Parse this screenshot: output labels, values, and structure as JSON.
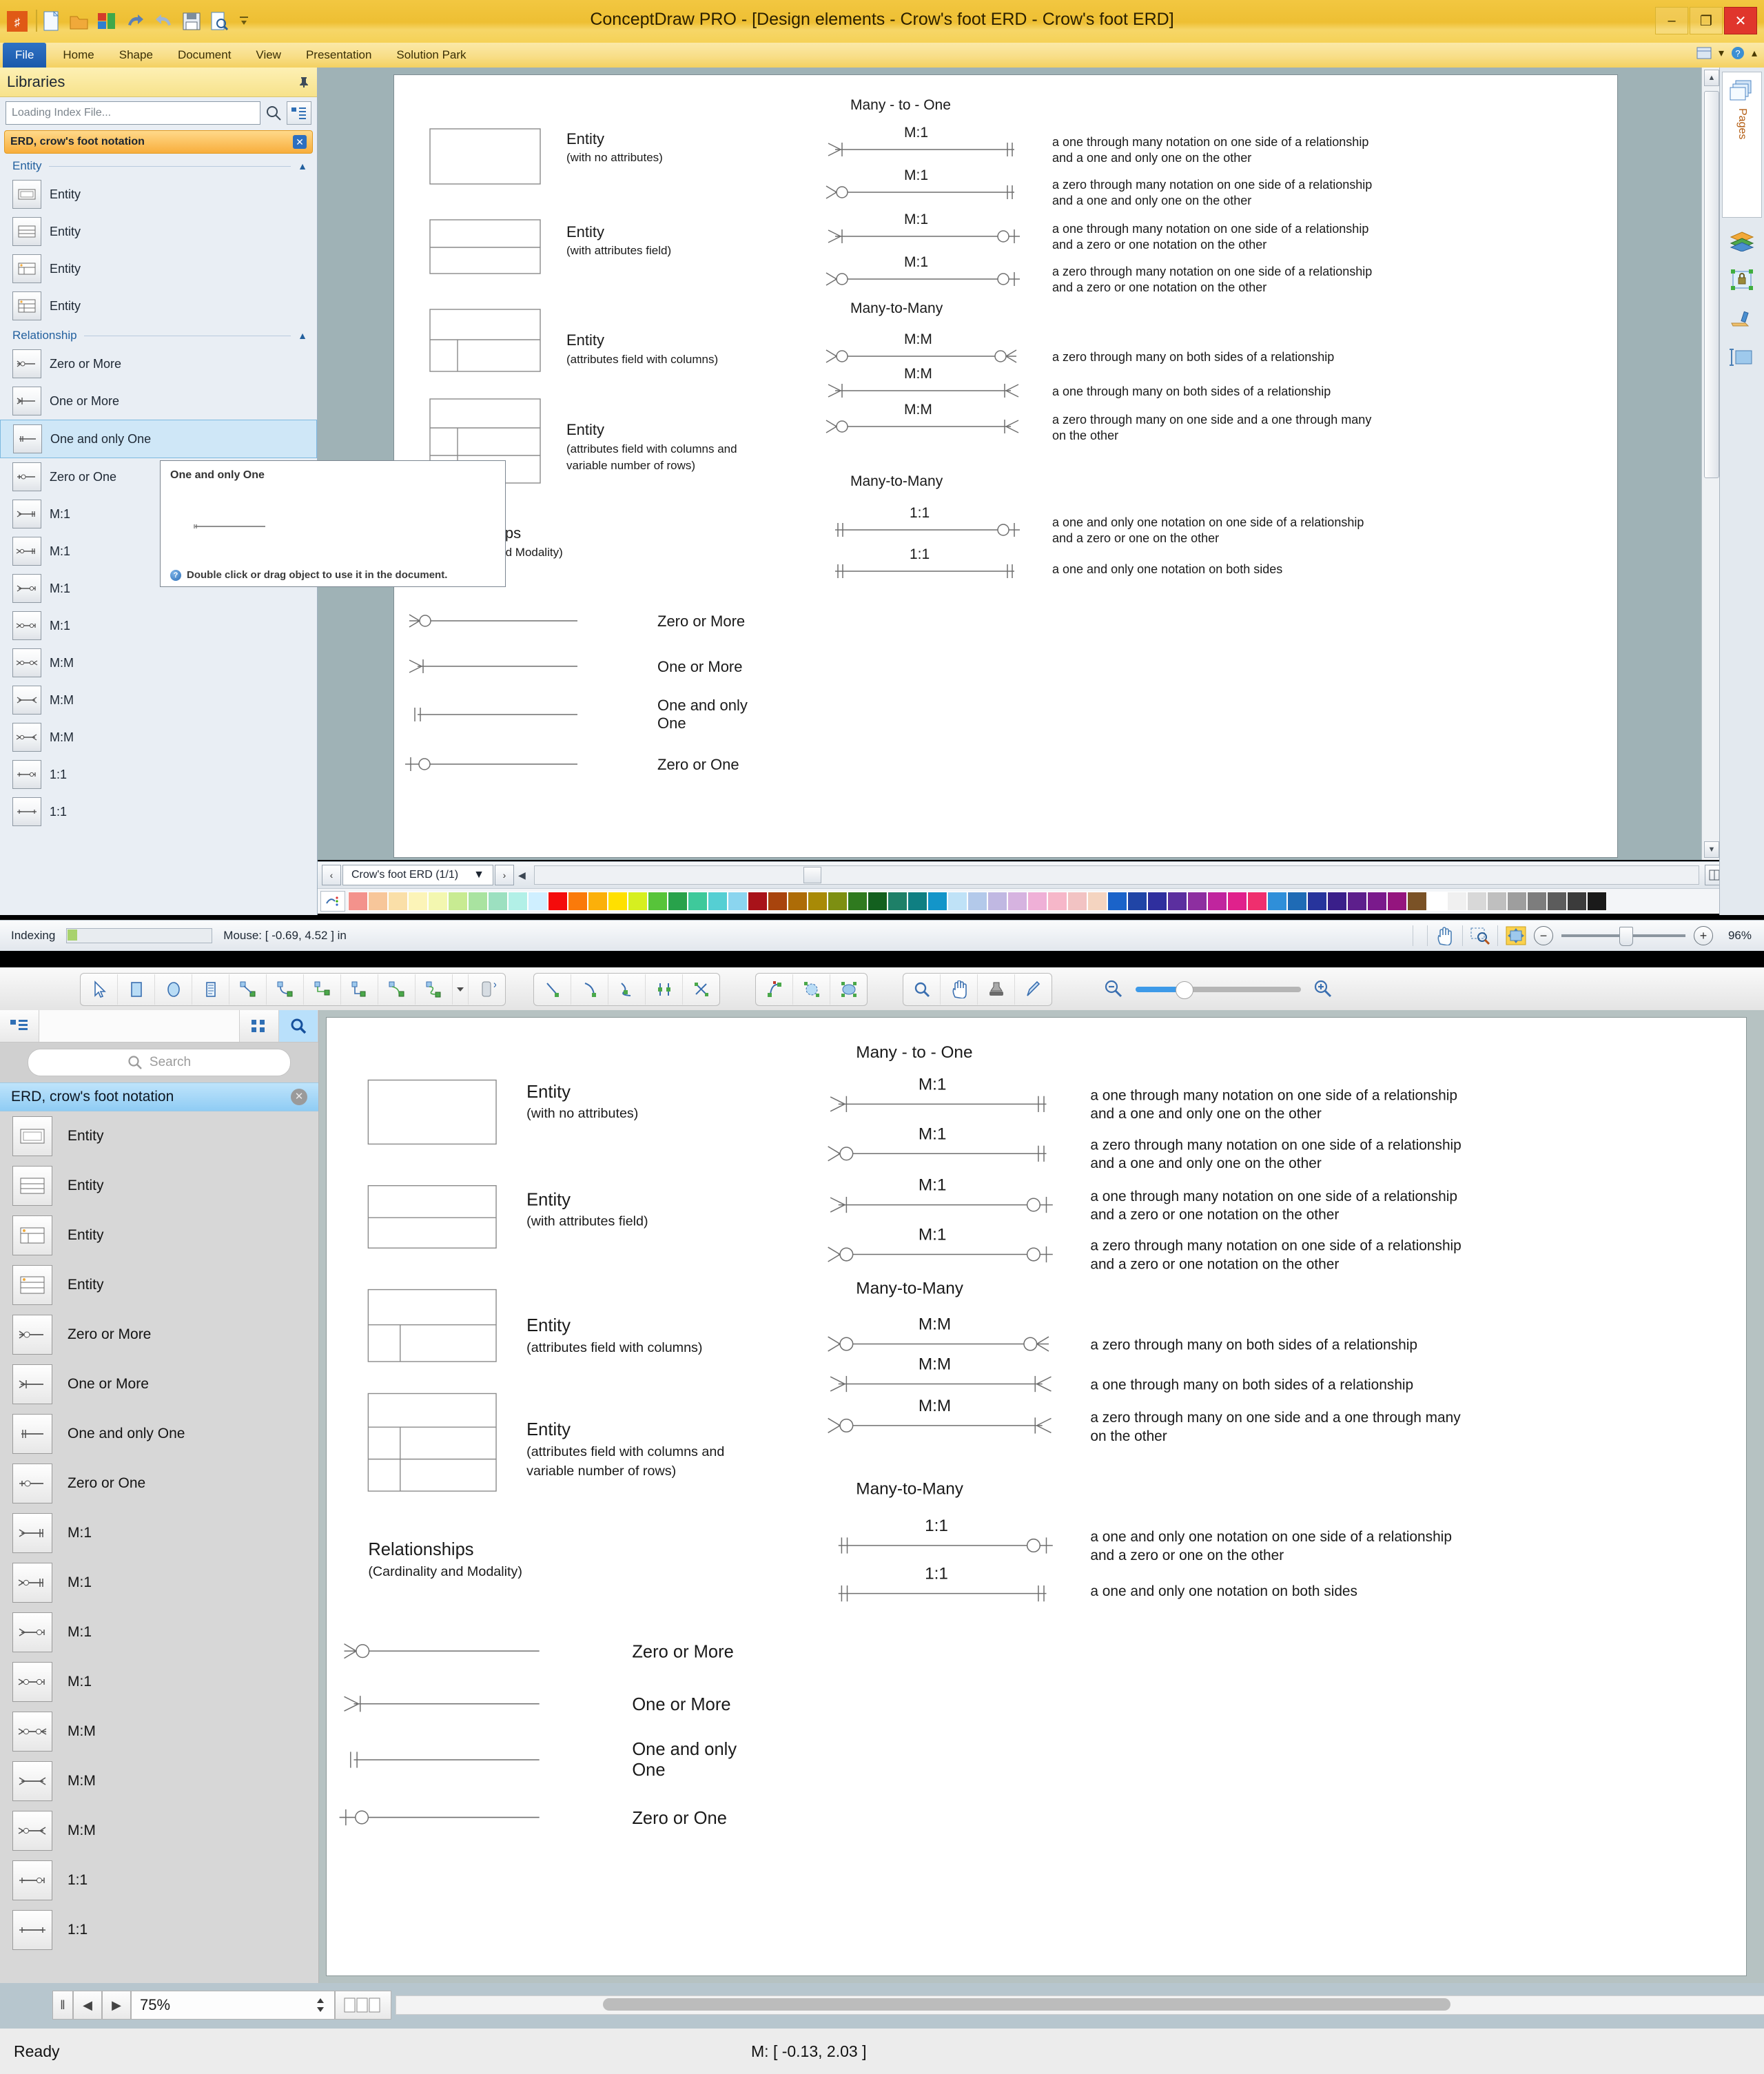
{
  "window": {
    "title": "ConceptDraw PRO - [Design elements - Crow's foot ERD - Crow's foot ERD]",
    "minimize": "–",
    "restore": "❐",
    "close": "✕"
  },
  "ribbon": {
    "tabs": [
      "File",
      "Home",
      "Shape",
      "Document",
      "View",
      "Presentation",
      "Solution Park"
    ],
    "right_icons": [
      "window-icon",
      "help-icon",
      "chevron-down-icon",
      "minimize-ribbon-icon"
    ]
  },
  "quick_access": {
    "icons": [
      "app-logo-icon",
      "new-document-icon",
      "open-folder-icon",
      "save-as-icon",
      "undo-icon",
      "redo-icon",
      "save-icon",
      "print-preview-icon",
      "customize-qat-icon"
    ]
  },
  "libraries_panel": {
    "header": "Libraries",
    "pin_icon": "pin-icon",
    "search_value": "Loading Index File...",
    "search_icon": "search-icon",
    "tree_view_icon": "tree-view-icon",
    "library_title": "ERD, crow's foot notation",
    "close_icon": "✕",
    "groups": [
      {
        "name": "Entity",
        "collapse_icon": "chevron-up-icon",
        "items": [
          {
            "label": "Entity",
            "shape": "entity-plain"
          },
          {
            "label": "Entity",
            "shape": "entity-attr"
          },
          {
            "label": "Entity",
            "shape": "entity-cols"
          },
          {
            "label": "Entity",
            "shape": "entity-rows"
          }
        ]
      },
      {
        "name": "Relationship",
        "collapse_icon": "chevron-up-icon",
        "items": [
          {
            "label": "Zero or More",
            "shape": "rel-zero-more",
            "selected": false
          },
          {
            "label": "One or More",
            "shape": "rel-one-more",
            "selected": false
          },
          {
            "label": "One and only One",
            "shape": "rel-one-only",
            "selected": true
          },
          {
            "label": "Zero or One",
            "shape": "rel-zero-one",
            "selected": false
          },
          {
            "label": "M:1",
            "shape": "rel-m1-a",
            "selected": false
          },
          {
            "label": "M:1",
            "shape": "rel-m1-b",
            "selected": false
          },
          {
            "label": "M:1",
            "shape": "rel-m1-c",
            "selected": false
          },
          {
            "label": "M:1",
            "shape": "rel-m1-d",
            "selected": false
          },
          {
            "label": "M:M",
            "shape": "rel-mm-a",
            "selected": false
          },
          {
            "label": "M:M",
            "shape": "rel-mm-b",
            "selected": false
          },
          {
            "label": "M:M",
            "shape": "rel-mm-c",
            "selected": false
          },
          {
            "label": "1:1",
            "shape": "rel-11-a",
            "selected": false
          },
          {
            "label": "1:1",
            "shape": "rel-11-b",
            "selected": false
          }
        ]
      }
    ]
  },
  "tooltip": {
    "title": "One and only One",
    "hint": "Double click or drag object to use it in the document.",
    "help_icon": "help-icon"
  },
  "page_bar": {
    "prev": "‹",
    "next": "›",
    "tab_label": "Crow's foot ERD (1/1)",
    "dropdown_icon": "▼",
    "scroll_left": "◀",
    "split_icon": "split-view-icon"
  },
  "status_bar": {
    "indexing_label": "Indexing",
    "mouse_label": "Mouse: [ -0.69, 4.52 ] in",
    "hand_icon": "hand-icon",
    "zoom_region_icon": "zoom-region-icon",
    "fit_icon": "fit-to-page-icon",
    "zoom_out": "−",
    "zoom_in": "+",
    "zoom_value": "96%"
  },
  "right_dock": {
    "pages_label": "Pages",
    "pages_icon": "pages-icon",
    "icons": [
      "layers-icon",
      "lock-shape-icon",
      "format-painter-icon",
      "size-position-icon"
    ]
  },
  "diagram": {
    "entities": [
      {
        "name": "Entity",
        "sub": "(with no attributes)",
        "shape": "entity-plain"
      },
      {
        "name": "Entity",
        "sub": "(with attributes field)",
        "shape": "entity-attr"
      },
      {
        "name": "Entity",
        "sub": "(attributes field with columns)",
        "shape": "entity-cols"
      },
      {
        "name": "Entity",
        "sub": "(attributes field with columns and\nvariable number of rows)",
        "shape": "entity-rows"
      }
    ],
    "relationships_title": "Relationships",
    "relationships_sub": "(Cardinality and Modality)",
    "relationships": [
      {
        "label": "Zero or More",
        "end": "zero-more"
      },
      {
        "label": "One or More",
        "end": "one-more"
      },
      {
        "label": "One and only\nOne",
        "end": "one-only"
      },
      {
        "label": "Zero or One",
        "end": "zero-one"
      }
    ],
    "sections": [
      {
        "title": "Many - to - One",
        "rows": [
          {
            "card": "M:1",
            "left": "one-more",
            "right": "one-only",
            "desc": "a one through many notation on one side of a relationship\nand a one and only one on the other"
          },
          {
            "card": "M:1",
            "left": "zero-more",
            "right": "one-only",
            "desc": "a zero through many notation on one side of a relationship\nand a one and only one on the other"
          },
          {
            "card": "M:1",
            "left": "one-more",
            "right": "zero-one",
            "desc": "a one through many notation on one side of a relationship\nand a zero or one notation on the other"
          },
          {
            "card": "M:1",
            "left": "zero-more",
            "right": "zero-one",
            "desc": "a zero through many notation on one side of a relationship\nand a zero or one notation on the other"
          }
        ]
      },
      {
        "title": "Many-to-Many",
        "rows": [
          {
            "card": "M:M",
            "left": "zero-more",
            "right": "zero-more-r",
            "desc": "a zero through many on both sides of a relationship"
          },
          {
            "card": "M:M",
            "left": "one-more",
            "right": "one-more-r",
            "desc": "a one through many on both sides of a relationship"
          },
          {
            "card": "M:M",
            "left": "zero-more",
            "right": "one-more-r",
            "desc": "a zero through many on one side and a one through many\non the other"
          }
        ]
      },
      {
        "title": "Many-to-Many",
        "rows": [
          {
            "card": "1:1",
            "left": "one-only",
            "right": "zero-one",
            "desc": "a one and only one notation on one side of a relationship\nand a zero or one on the other"
          },
          {
            "card": "1:1",
            "left": "one-only",
            "right": "one-only",
            "desc": "a one and only one notation on both sides"
          }
        ]
      }
    ]
  },
  "bottom_window": {
    "toolbar_groups": [
      {
        "name": "draw-tools",
        "icons": [
          "pointer-icon",
          "rectangle-icon",
          "ellipse-icon",
          "text-icon",
          "line-connector-icon",
          "elbow-connector-icon",
          "smart-connector-icon",
          "right-angle-connector-icon",
          "curved-connector-icon",
          "bezier-connector-icon",
          "connector-dropdown-icon",
          "delete-connector-icon"
        ]
      },
      {
        "name": "line-tools",
        "icons": [
          "straight-line-icon",
          "arc-icon",
          "curve-icon",
          "node-edit-icon",
          "trim-icon"
        ]
      },
      {
        "name": "transform-tools",
        "icons": [
          "rotate-icon",
          "reshape-icon",
          "resize-icon"
        ]
      },
      {
        "name": "view-tools",
        "icons": [
          "zoom-icon",
          "hand-icon",
          "stamp-icon",
          "eyedropper-icon"
        ]
      }
    ],
    "zoom_out_icon": "zoom-out-icon",
    "zoom_in_icon": "zoom-in-icon",
    "panel": {
      "tree_icon": "tree-view-icon",
      "grid_icon": "grid-view-icon",
      "search_icon": "search-icon",
      "search_placeholder": "Search",
      "library_title": "ERD, crow's foot notation",
      "close_icon": "✕",
      "items": [
        {
          "label": "Entity",
          "shape": "entity-plain"
        },
        {
          "label": "Entity",
          "shape": "entity-attr"
        },
        {
          "label": "Entity",
          "shape": "entity-cols"
        },
        {
          "label": "Entity",
          "shape": "entity-rows"
        },
        {
          "label": "Zero or More",
          "shape": "rel-zero-more"
        },
        {
          "label": "One or More",
          "shape": "rel-one-more"
        },
        {
          "label": "One and only One",
          "shape": "rel-one-only"
        },
        {
          "label": "Zero or One",
          "shape": "rel-zero-one"
        },
        {
          "label": "M:1",
          "shape": "rel-m1-a"
        },
        {
          "label": "M:1",
          "shape": "rel-m1-b"
        },
        {
          "label": "M:1",
          "shape": "rel-m1-c"
        },
        {
          "label": "M:1",
          "shape": "rel-m1-d"
        },
        {
          "label": "M:M",
          "shape": "rel-mm-a"
        },
        {
          "label": "M:M",
          "shape": "rel-mm-b"
        },
        {
          "label": "M:M",
          "shape": "rel-mm-c"
        },
        {
          "label": "1:1",
          "shape": "rel-11-a"
        },
        {
          "label": "1:1",
          "shape": "rel-11-b"
        }
      ]
    },
    "status": {
      "pause_icon": "‖",
      "prev_icon": "◀",
      "next_icon": "▶",
      "zoom_value": "75%",
      "stepper_icon": "stepper-icon",
      "view_mode_icon": "view-mode-icon",
      "ready_label": "Ready",
      "mouse_label": "M: [ -0.13, 2.03 ]"
    }
  },
  "colors": {
    "title_gold": "#f2c741",
    "ribbon_blue": "#1b59ab",
    "library_orange": "#f8ae3c",
    "selection_blue": "#cfe7f7",
    "mac_blue": "#8fccf4",
    "canvas_gray": "#9fb2b6",
    "canvas_gray2": "#b6c2c2"
  }
}
